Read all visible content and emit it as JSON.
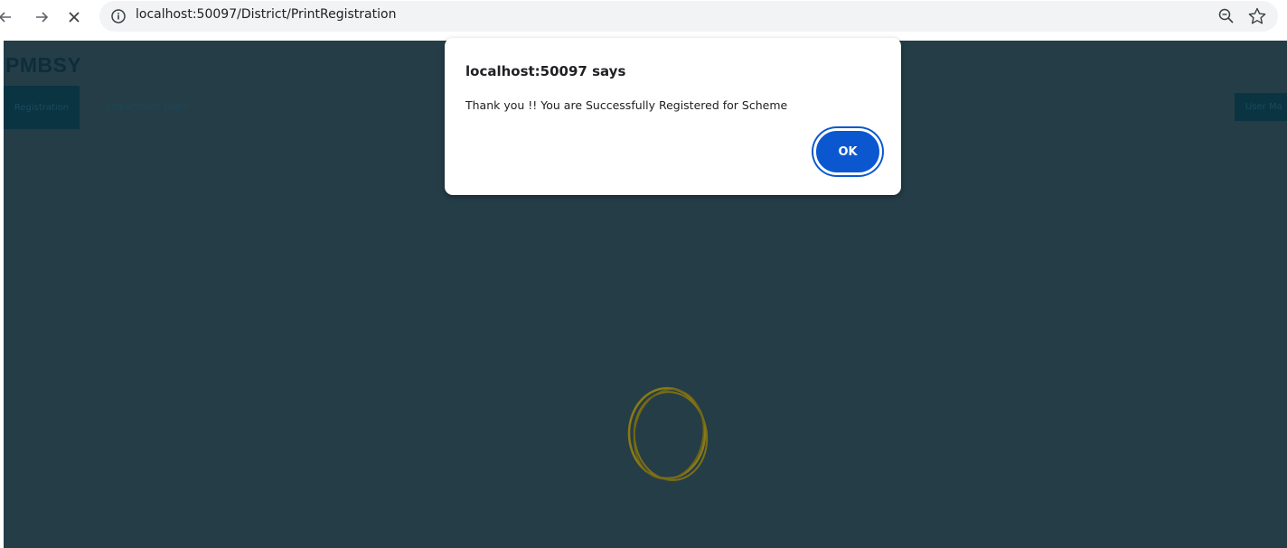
{
  "browser": {
    "url": "localhost:50097/District/PrintRegistration"
  },
  "page": {
    "brand": "PMBSY",
    "nav": {
      "registration": "Registration",
      "department_login": "Department Login",
      "user_menu": "User Ma"
    }
  },
  "dialog": {
    "title": "localhost:50097 says",
    "message": "Thank you !! You are Successfully Registered for Scheme",
    "ok_label": "OK"
  },
  "icons": {
    "back": "back-arrow-icon",
    "forward": "forward-arrow-icon",
    "stop": "close-icon",
    "info": "info-icon",
    "zoom": "zoom-icon",
    "bookmark": "star-icon",
    "loading": "loading-spinner-icon"
  },
  "colors": {
    "overlay": "#253d47",
    "ok_button": "#0b57d0",
    "spinner": "#8a7a17"
  }
}
